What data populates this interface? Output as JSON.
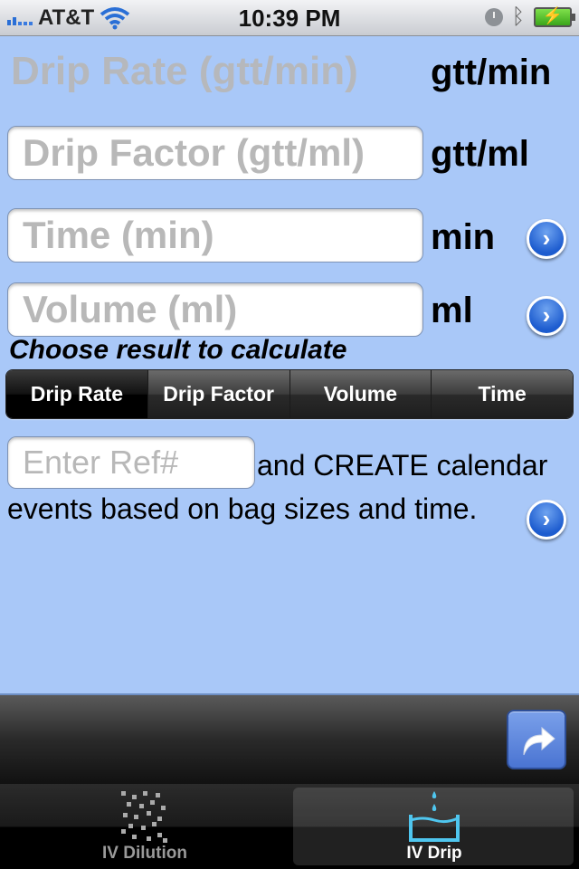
{
  "status_bar": {
    "carrier": "AT&T",
    "time": "10:39 PM",
    "icons": [
      "signal-icon",
      "wifi-icon",
      "clock-icon",
      "bluetooth-icon",
      "battery-charging-icon"
    ]
  },
  "result": {
    "label": "Drip Rate (gtt/min)",
    "unit": "gtt/min"
  },
  "fields": [
    {
      "placeholder": "Drip Factor (gtt/ml)",
      "value": "",
      "unit": "gtt/ml",
      "has_disclosure": false
    },
    {
      "placeholder": "Time (min)",
      "value": "",
      "unit": "min",
      "has_disclosure": true
    },
    {
      "placeholder": "Volume (ml)",
      "value": "",
      "unit": "ml",
      "has_disclosure": true
    }
  ],
  "choose_label": "Choose result to calculate",
  "segments": {
    "items": [
      "Drip Rate",
      "Drip Factor",
      "Volume",
      "Time"
    ],
    "selected": "Drip Rate"
  },
  "calendar": {
    "ref_placeholder": "Enter Ref#",
    "ref_value": "",
    "line1": "and CREATE calendar",
    "line2": "events based on bag sizes and time."
  },
  "disclosure_glyph": "›",
  "toolbar": {
    "share_icon": "share-arrow-icon"
  },
  "tabs": [
    {
      "label": "IV Dilution",
      "icon": "dots-dilution-icon",
      "active": false
    },
    {
      "label": "IV Drip",
      "icon": "drip-basin-icon",
      "active": true
    }
  ],
  "colors": {
    "background": "#a9c8f8",
    "accent": "#1d5ccf",
    "active_tab_icon": "#4fc6ef"
  }
}
